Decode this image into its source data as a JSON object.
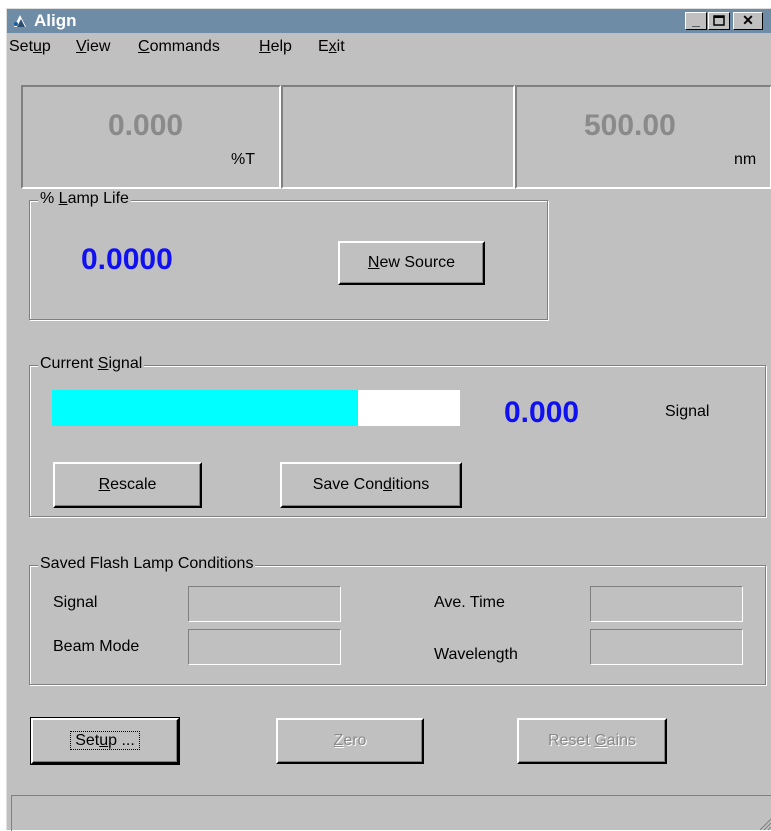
{
  "window": {
    "title": "Align"
  },
  "menu": [
    {
      "pre": "Set",
      "key": "u",
      "post": "p"
    },
    {
      "pre": "",
      "key": "V",
      "post": "iew"
    },
    {
      "pre": "",
      "key": "C",
      "post": "ommands"
    },
    {
      "pre": "",
      "key": "H",
      "post": "elp"
    },
    {
      "pre": "E",
      "key": "x",
      "post": "it"
    }
  ],
  "readout": {
    "transmittance": "0.000",
    "transmittance_unit": "%T",
    "wavelength": "500.00",
    "wavelength_unit": "nm"
  },
  "lamp_life": {
    "label_pre": "% ",
    "label_key": "L",
    "label_post": "amp Life",
    "value": "0.0000",
    "new_source": {
      "pre": "",
      "key": "N",
      "post": "ew Source"
    }
  },
  "current_signal": {
    "label_pre": "Current ",
    "label_key": "S",
    "label_post": "ignal",
    "level": 0.75,
    "value": "0.000",
    "value_label": "Signal",
    "rescale": {
      "pre": "",
      "key": "R",
      "post": "escale"
    },
    "save_conditions": {
      "pre": "Save Con",
      "key": "d",
      "post": "itions"
    }
  },
  "saved_conditions": {
    "label": "Saved Flash Lamp Conditions",
    "signal_label": "Signal",
    "beam_mode_label": "Beam Mode",
    "ave_time_label": "Ave. Time",
    "wavelength_label": "Wavelength"
  },
  "buttons": {
    "setup": {
      "pre": "Set",
      "key": "u",
      "post": "p ..."
    },
    "zero": {
      "pre": "",
      "key": "Z",
      "post": "ero"
    },
    "reset_gains": {
      "pre": "Reset ",
      "key": "G",
      "post": "ains"
    }
  },
  "colors": {
    "signal_bar": "#00ffff",
    "value_blue": "#1010f0",
    "titlebar": "#6e8ca6"
  },
  "icons": [
    "app-icon",
    "minimize-icon",
    "maximize-icon",
    "close-icon",
    "resize-grip-icon"
  ]
}
